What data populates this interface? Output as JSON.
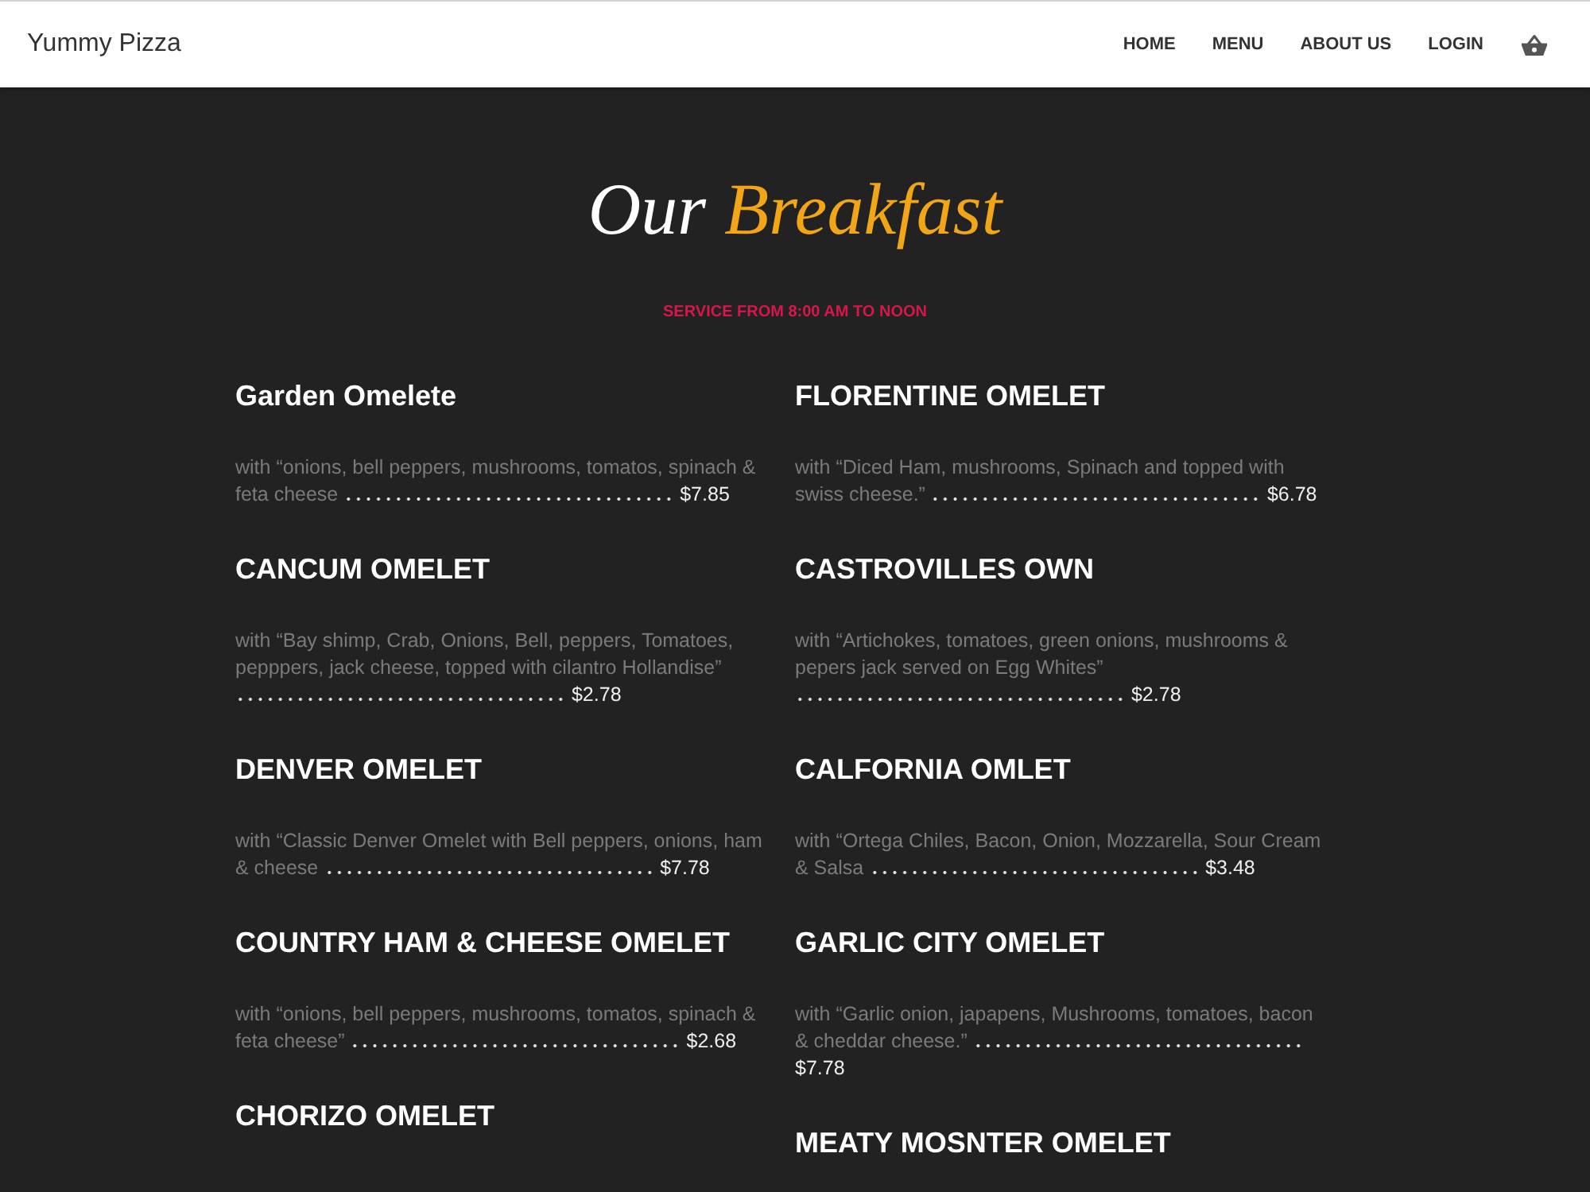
{
  "header": {
    "brand": "Yummy Pizza",
    "nav": [
      {
        "label": "HOME"
      },
      {
        "label": "MENU"
      },
      {
        "label": "ABOUT US"
      },
      {
        "label": "LOGIN"
      }
    ]
  },
  "hero": {
    "title": [
      {
        "text": "Our",
        "accent": false
      },
      {
        "text": "Breakfast",
        "accent": true
      }
    ],
    "subtitle": "SERVICE FROM 8:00 AM TO NOON"
  },
  "menu": {
    "columns": [
      [
        {
          "name": "Garden Omelete",
          "description": "with “onions, bell peppers, mushrooms, tomatos, spinach & feta cheese",
          "price": "$7.85"
        },
        {
          "name": "CANCUM OMELET",
          "description": "with “Bay shimp, Crab, Onions, Bell, peppers, Tomatoes, pepppers, jack cheese, topped with cilantro Hollandise”",
          "price": "$2.78"
        },
        {
          "name": "DENVER OMELET",
          "description": "with “Classic Denver Omelet with Bell peppers, onions, ham & cheese",
          "price": "$7.78"
        },
        {
          "name": "COUNTRY HAM & CHEESE OMELET",
          "description": "with “onions, bell peppers, mushrooms, tomatos, spinach & feta cheese”",
          "price": "$2.68"
        },
        {
          "name": "CHORIZO OMELET"
        }
      ],
      [
        {
          "name": "FLORENTINE OMELET",
          "description": "with “Diced Ham, mushrooms, Spinach and topped with swiss cheese.”",
          "price": "$6.78"
        },
        {
          "name": "CASTROVILLES OWN",
          "description": "with “Artichokes, tomatoes, green onions, mushrooms & pepers jack served on Egg Whites”",
          "price": "$2.78"
        },
        {
          "name": "CALFORNIA OMLET",
          "description": "with “Ortega Chiles, Bacon, Onion, Mozzarella, Sour Cream & Salsa",
          "price": "$3.48"
        },
        {
          "name": "GARLIC CITY OMELET",
          "description": "with “Garlic onion, japapens, Mushrooms, tomatoes, bacon & cheddar cheese.”",
          "price": "$7.78"
        },
        {
          "name": "MEATY MOSNTER OMELET"
        }
      ]
    ]
  }
}
